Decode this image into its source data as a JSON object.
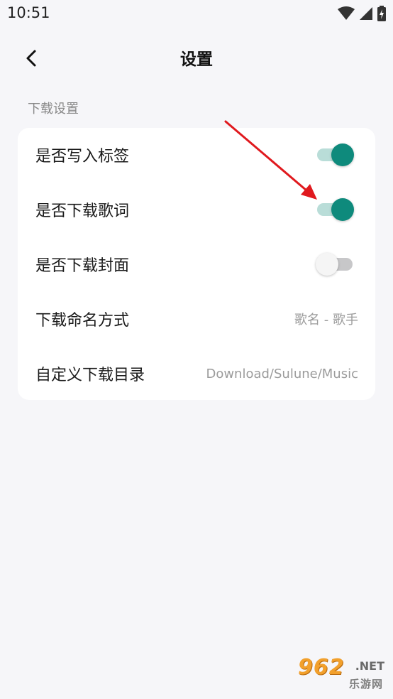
{
  "status_bar": {
    "time": "10:51",
    "icons": [
      "wifi-icon",
      "cell-signal-icon",
      "battery-charging-icon"
    ]
  },
  "header": {
    "back_icon": "chevron-left-icon",
    "title": "设置"
  },
  "section": {
    "title": "下载设置"
  },
  "settings": [
    {
      "label": "是否写入标签",
      "type": "toggle",
      "on": true
    },
    {
      "label": "是否下载歌词",
      "type": "toggle",
      "on": true
    },
    {
      "label": "是否下载封面",
      "type": "toggle",
      "on": false
    },
    {
      "label": "下载命名方式",
      "type": "value",
      "value": "歌名 - 歌手"
    },
    {
      "label": "自定义下载目录",
      "type": "value",
      "value": "Download/Sulune/Music"
    }
  ],
  "annotation": {
    "arrow_color": "#e0191e",
    "points_to": "是否下载歌词"
  },
  "watermark": {
    "brand": "962",
    "suffix": ".NET",
    "subtitle": "乐游网"
  },
  "colors": {
    "accent": "#0e8a7c",
    "accent_track": "#b9ddd8",
    "off_thumb": "#f5f5f5",
    "off_track": "#c7c7c9",
    "background": "#f6f6f9",
    "card": "#ffffff"
  }
}
